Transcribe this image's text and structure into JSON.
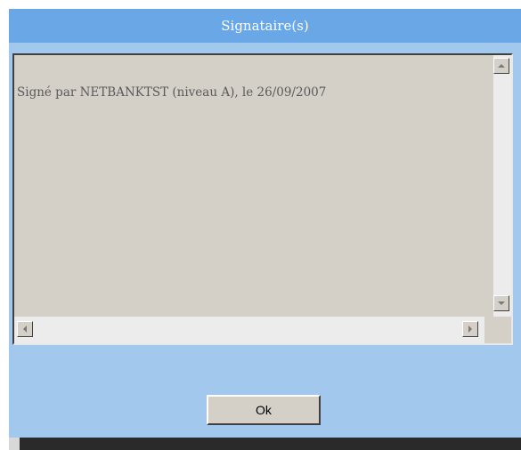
{
  "dialog": {
    "title": "Signataire(s)",
    "signatures_text": "Signé par NETBANKTST (niveau A), le 26/09/2007",
    "ok_label": "Ok"
  },
  "icons": {
    "scroll_up": "triangle-up-icon",
    "scroll_down": "triangle-down-icon",
    "scroll_left": "triangle-left-icon",
    "scroll_right": "triangle-right-icon"
  },
  "colors": {
    "titlebar": "#6aa7e6",
    "dialog_bg": "#a3c8ee",
    "textarea_bg": "#d4d0c8",
    "text": "#5a5a5a"
  }
}
